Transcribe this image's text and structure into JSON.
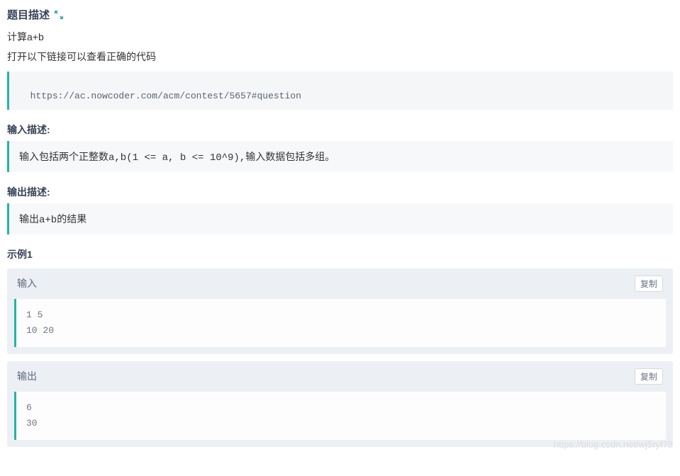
{
  "problem": {
    "title": "题目描述",
    "desc_lines": [
      "计算a+b",
      "打开以下链接可以查看正确的代码"
    ],
    "link": "https://ac.nowcoder.com/acm/contest/5657#question"
  },
  "input_desc": {
    "title": "输入描述:",
    "content": "输入包括两个正整数a,b(1 <= a, b <= 10^9),输入数据包括多组。"
  },
  "output_desc": {
    "title": "输出描述:",
    "content": "输出a+b的结果"
  },
  "example": {
    "title": "示例1",
    "input_label": "输入",
    "output_label": "输出",
    "copy_label": "复制",
    "input_data": "1 5\n10 20",
    "output_data": "6\n30"
  },
  "watermark": "https://blog.csdn.net/wj5ryf78"
}
